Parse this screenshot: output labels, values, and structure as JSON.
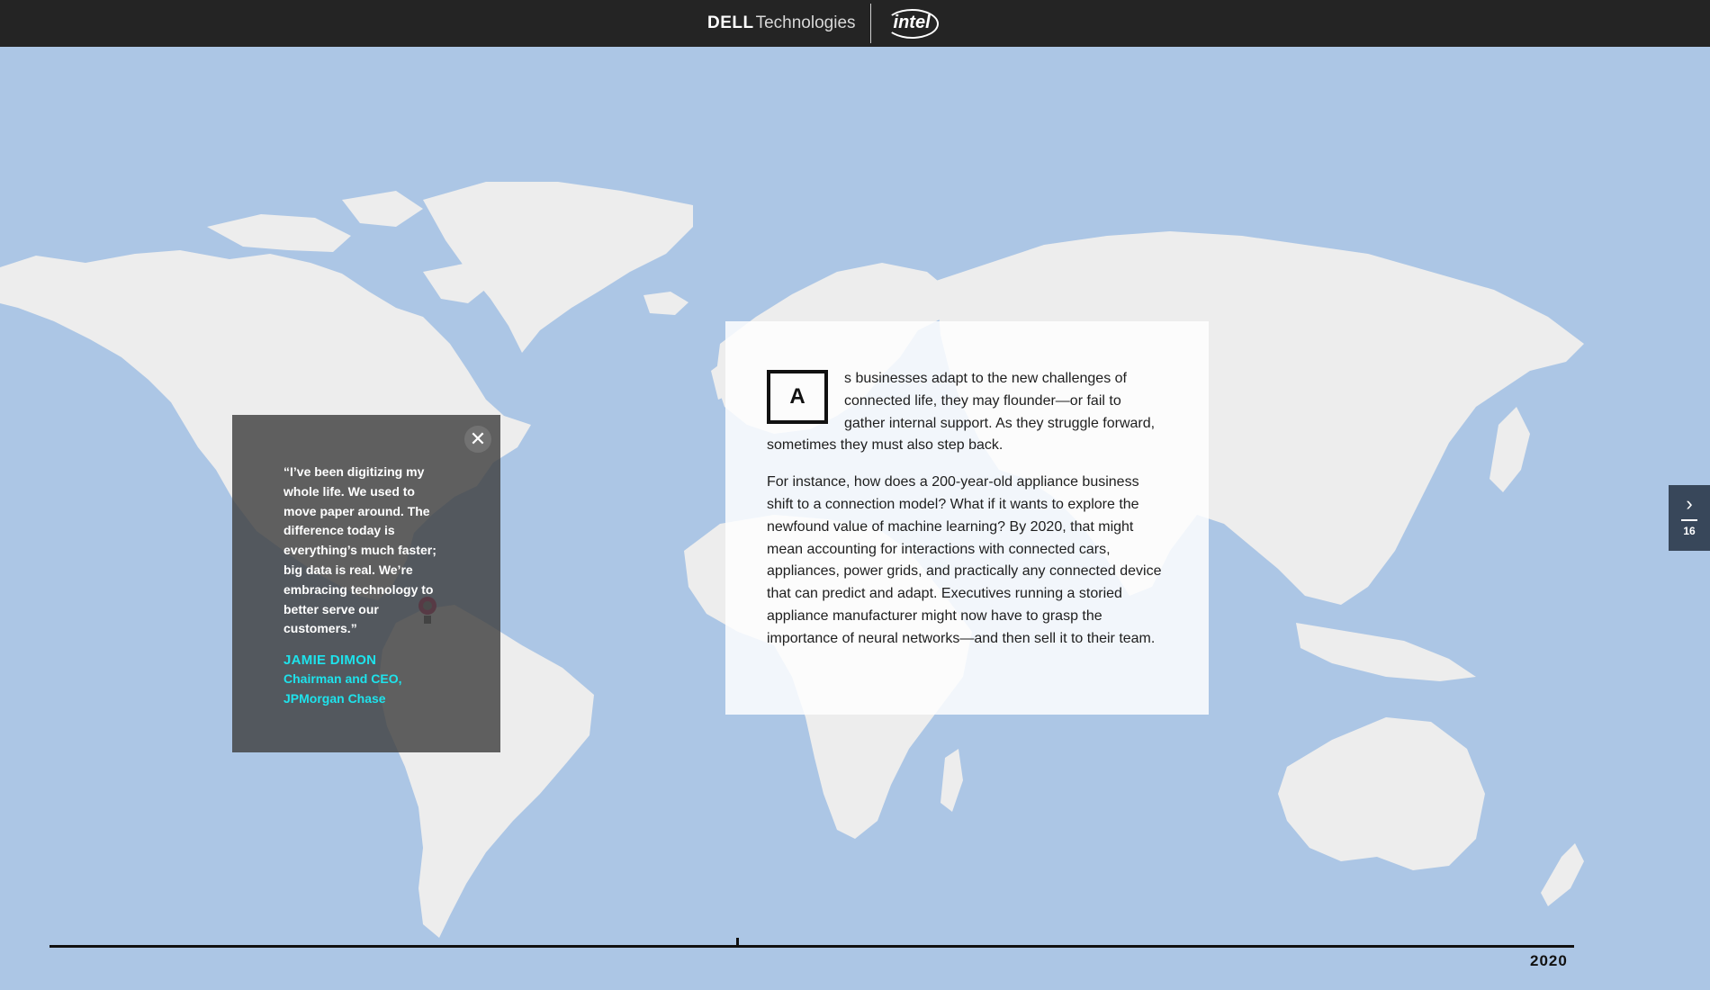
{
  "header": {
    "brand_dell": "DELL",
    "brand_technologies": "Technologies",
    "brand_intel": "intel"
  },
  "map": {
    "ocean_color": "#acc6e5",
    "land_color": "#ededed"
  },
  "quote_popup": {
    "close_icon": "close-icon",
    "close_glyph": "✕",
    "text": "“I’ve been digitizing my whole life. We used to move paper around. The difference today is everything’s much faster; big data is real. We’re embracing technology to better serve our customers.”",
    "name": "Jamie Dimon",
    "role_line1": "Chairman and CEO,",
    "role_line2": "JPMorgan Chase",
    "accent_color": "#1ee3ec"
  },
  "map_pin": {
    "icon": "map-pin-icon",
    "color": "#c2245d"
  },
  "story": {
    "dropcap": "A",
    "paragraph1": "s businesses adapt to the new challenges of connected life, they may flounder—or fail to gather internal support. As they struggle forward, sometimes they must also step back.",
    "paragraph2": "For instance, how does a 200-year-old appliance business shift to a connection model? What if it wants to explore the newfound value of machine learning? By 2020, that might mean accounting for interactions with connected cars, appliances, power grids, and practically any connected device that can predict and adapt. Executives running a storied appliance manufacturer might now have to grasp the importance of neural networks—and then sell it to their team."
  },
  "next_tab": {
    "icon": "chevron-right-icon",
    "glyph": "›",
    "page_number": "16"
  },
  "timeline": {
    "year_label": "2020"
  }
}
